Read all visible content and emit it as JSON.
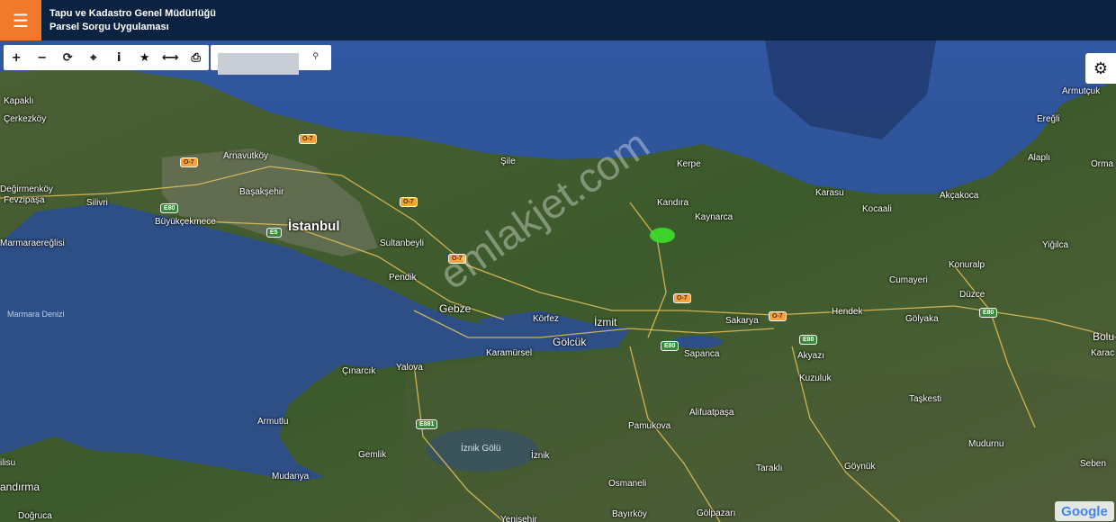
{
  "header": {
    "menu_icon": "hamburger-icon",
    "title_line1": "Tapu ve Kadastro Genel Müdürlüğü",
    "title_line2": "Parsel Sorgu Uygulaması"
  },
  "toolbar": {
    "tools": [
      {
        "name": "zoom-in-button",
        "icon": "plus-icon",
        "glyph": "+"
      },
      {
        "name": "zoom-out-button",
        "icon": "minus-icon",
        "glyph": "−"
      },
      {
        "name": "refresh-button",
        "icon": "refresh-icon",
        "glyph": "⟳"
      },
      {
        "name": "locate-button",
        "icon": "crosshair-icon",
        "glyph": "⌖"
      },
      {
        "name": "info-button",
        "icon": "info-icon",
        "glyph": "i"
      },
      {
        "name": "favorite-button",
        "icon": "star-icon",
        "glyph": "★"
      },
      {
        "name": "measure-button",
        "icon": "measure-icon",
        "glyph": "⟷"
      },
      {
        "name": "print-button",
        "icon": "print-icon",
        "glyph": "⎙"
      }
    ],
    "search_value": "",
    "search_icon": "location-pin-icon",
    "search_glyph": "⚲"
  },
  "settings": {
    "icon": "gear-icon",
    "glyph": "⚙"
  },
  "map": {
    "labels": {
      "kapakli": "Kapaklı",
      "cerkezkoy": "Çerkezköy",
      "arnavutkoy": "Arnavutköy",
      "degirmenkoy": "Değirmenköy",
      "fevzipasa": "Fevzipaşa",
      "basaksehir": "Başakşehir",
      "silivri": "Silivri",
      "buyukcekmece": "Büyükçekmece",
      "istanbul": "İstanbul",
      "sultanbeyli": "Sultanbeyli",
      "marmaraereglisi": "Marmaraereğlisi",
      "sile": "Şile",
      "kerpe": "Kerpe",
      "kandira": "Kandıra",
      "kaynarca": "Kaynarca",
      "karasu": "Karasu",
      "kocaali": "Kocaali",
      "akcakoca": "Akçakoca",
      "armutcuk": "Armutçuk",
      "eregli": "Ereğli",
      "alapli": "Alaplı",
      "orma": "Orma",
      "yigilca": "Yiğilca",
      "konuralp": "Konuralp",
      "cumayeri": "Cumayeri",
      "duzce": "Düzce",
      "golyaka": "Gölyaka",
      "hendek": "Hendek",
      "pendik": "Pendik",
      "gebze": "Gebze",
      "korfez": "Körfez",
      "izmit": "İzmit",
      "golcuk": "Gölcük",
      "sakarya": "Sakarya",
      "sapanca": "Sapanca",
      "akyazi": "Akyazı",
      "kuzuluk": "Kuzuluk",
      "karamursel": "Karamürsel",
      "cinarcik": "Çınarcık",
      "yalova": "Yalova",
      "marmara_denizi": "Marmara Denizi",
      "armutlu": "Armutlu",
      "silivri2": "ilisu",
      "mudanya": "Mudanya",
      "gemlik": "Gemlik",
      "iznik_golu": "İznik Gölü",
      "iznik": "İznik",
      "pamukova": "Pamukova",
      "alifuatpasa": "Alifuatpaşa",
      "taskesti": "Taşkesti",
      "mudurnu": "Mudurnu",
      "tarakli": "Taraklı",
      "goynuk": "Göynük",
      "seben": "Seben",
      "osmaneli": "Osmaneli",
      "bolu": "Bolu",
      "karac": "Karac",
      "bandirma": "andırma",
      "dogruca": "Doğruca",
      "bayirkoy": "Bayırköy",
      "golpazari": "Gölpazarı",
      "yenisehir": "Yenişehir"
    },
    "roads": {
      "o7": "O-7",
      "e80": "E80",
      "e5": "E5",
      "e881": "E881"
    },
    "watermark": "emlakjet.com",
    "attribution": "Google"
  },
  "colors": {
    "header_bg": "#0b2340",
    "menu_accent": "#f07a2a",
    "marker": "#3be02a",
    "sea": "#2d4f86",
    "land": "#3f5a2e"
  }
}
